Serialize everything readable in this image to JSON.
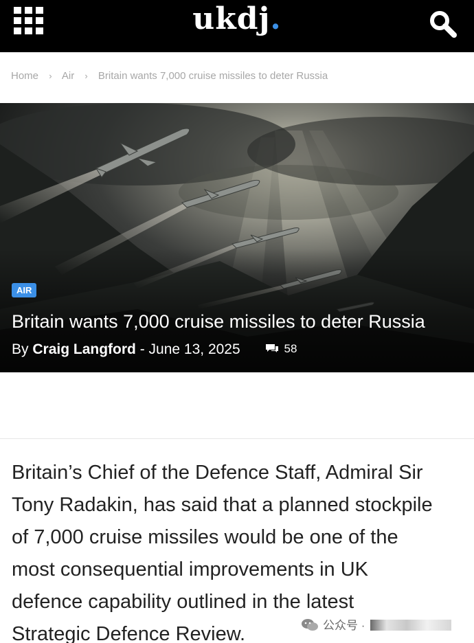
{
  "header": {
    "logo_text": "ukdj",
    "logo_dot": ".",
    "logo_dot_color": "#3b8fe6",
    "menu_icon": "grid-menu-icon",
    "search_icon": "search-icon"
  },
  "breadcrumb": {
    "items": [
      "Home",
      "Air",
      "Britain wants 7,000 cruise missiles to deter Russia"
    ],
    "separator": "›"
  },
  "hero": {
    "category": "AIR",
    "title": "Britain wants 7,000 cruise missiles to deter Russia",
    "by_label": "By",
    "author": "Craig Langford",
    "date_separator": "-",
    "date": "June 13, 2025",
    "comment_count": "58",
    "accent_color": "#3b8fe6"
  },
  "article": {
    "lines": [
      "Britain’s Chief of the Defence Staff, Admiral Sir",
      "Tony Radakin, has said that a planned stockpile",
      "of 7,000 cruise missiles would be one of the",
      "most consequential improvements in UK",
      "defence capability outlined in the latest",
      "Strategic Defence Review."
    ]
  },
  "watermark": {
    "text": "公众号 ·"
  }
}
